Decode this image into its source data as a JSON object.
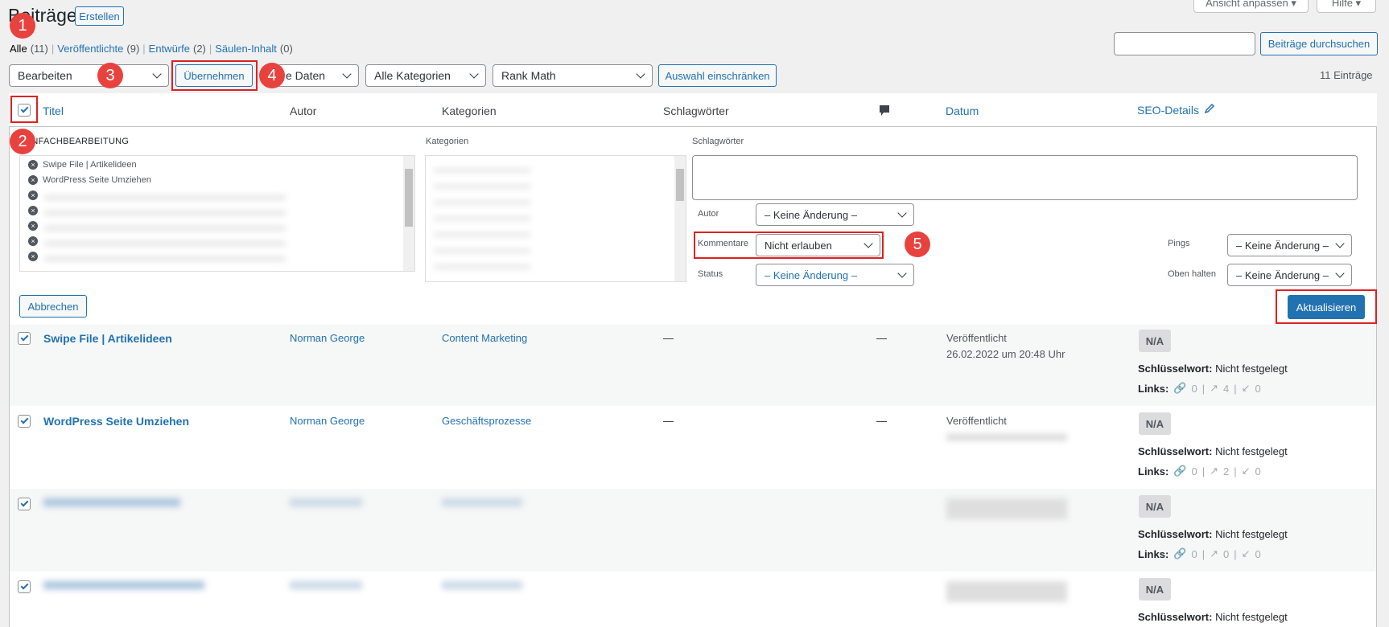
{
  "page": {
    "title": "Beiträge",
    "create_button": "Erstellen",
    "screen_options": "Ansicht anpassen ▾",
    "help": "Hilfe ▾"
  },
  "filters": {
    "all": "Alle",
    "all_count": "(11)",
    "published": "Veröffentlichte",
    "published_count": "(9)",
    "drafts": "Entwürfe",
    "drafts_count": "(2)",
    "columns": "Säulen-Inhalt",
    "columns_count": "(0)",
    "sep": "|"
  },
  "search": {
    "button": "Beiträge durchsuchen",
    "value": ""
  },
  "bulk": {
    "action_selected": "Bearbeiten",
    "apply": "Übernehmen",
    "dates_selected": "Alle Daten",
    "dates_visible": "e Daten",
    "categories_selected": "Alle Kategorien",
    "seo_selected": "Rank Math",
    "filter_button": "Auswahl einschränken",
    "count": "11 Einträge"
  },
  "columns": {
    "title": "Titel",
    "author": "Autor",
    "categories": "Kategorien",
    "tags": "Schlagwörter",
    "date": "Datum",
    "seo": "SEO-Details"
  },
  "bulk_edit": {
    "heading": "EINFACHBEARBEITUNG",
    "heading_visible": "INFACHBEARBEITUNG",
    "posts": [
      "Swipe File | Artikelideen",
      "WordPress Seite Umziehen"
    ],
    "categories_label": "Kategorien",
    "tags_label": "Schlagwörter",
    "author_label": "Autor",
    "author_value": "– Keine Änderung –",
    "comments_label": "Kommentare",
    "comments_value": "Nicht erlauben",
    "status_label": "Status",
    "status_value": "– Keine Änderung –",
    "pings_label": "Pings",
    "pings_value": "– Keine Änderung –",
    "sticky_label": "Oben halten",
    "sticky_value": "– Keine Änderung –",
    "cancel": "Abbrechen",
    "update": "Aktualisieren"
  },
  "rows": [
    {
      "title": "Swipe File | Artikelideen",
      "author": "Norman George",
      "category": "Content Marketing",
      "tags": "—",
      "comments": "—",
      "status": "Veröffentlicht",
      "date": "26.02.2022 um 20:48 Uhr",
      "na": "N/A",
      "kw_label": "Schlüsselwort:",
      "kw_value": "Nicht festgelegt",
      "links_label": "Links:",
      "l1": "0",
      "l2": "4",
      "l3": "0"
    },
    {
      "title": "WordPress Seite Umziehen",
      "author": "Norman George",
      "category": "Geschäftsprozesse",
      "tags": "—",
      "comments": "—",
      "status": "Veröffentlicht",
      "date": "",
      "na": "N/A",
      "kw_label": "Schlüsselwort:",
      "kw_value": "Nicht festgelegt",
      "links_label": "Links:",
      "l1": "0",
      "l2": "2",
      "l3": "0"
    },
    {
      "na": "N/A",
      "kw_label": "Schlüsselwort:",
      "kw_value": "Nicht festgelegt",
      "links_label": "Links:",
      "l1": "0",
      "l2": "0",
      "l3": "0"
    },
    {
      "na": "N/A",
      "kw_label": "Schlüsselwort:",
      "kw_value": "Nicht festgelegt"
    }
  ],
  "annotations": [
    "1",
    "2",
    "3",
    "4",
    "5"
  ],
  "colors": {
    "accent": "#2271b1",
    "annotation": "#e8423f",
    "highlight_box": "#e02020"
  }
}
